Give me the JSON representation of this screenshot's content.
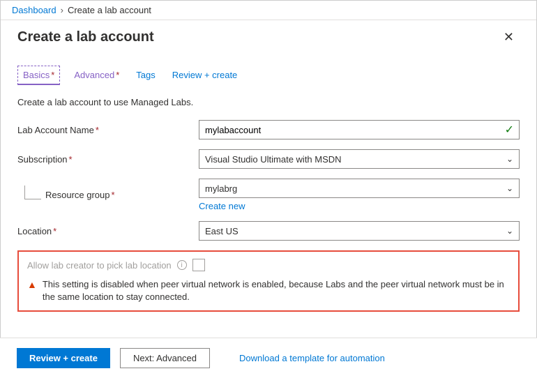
{
  "breadcrumb": {
    "root": "Dashboard",
    "current": "Create a lab account"
  },
  "header": {
    "title": "Create a lab account"
  },
  "tabs": {
    "basics": "Basics",
    "advanced": "Advanced",
    "tags": "Tags",
    "review": "Review + create"
  },
  "intro": "Create a lab account to use Managed Labs.",
  "form": {
    "labAccountName": {
      "label": "Lab Account Name",
      "value": "mylabaccount"
    },
    "subscription": {
      "label": "Subscription",
      "value": "Visual Studio Ultimate with MSDN"
    },
    "resourceGroup": {
      "label": "Resource group",
      "value": "mylabrg",
      "createNew": "Create new"
    },
    "location": {
      "label": "Location",
      "value": "East US"
    }
  },
  "allowBox": {
    "label": "Allow lab creator to pick lab location",
    "warning": "This setting is disabled when peer virtual network is enabled, because Labs and the peer virtual network must be in the same location to stay connected."
  },
  "footer": {
    "review": "Review + create",
    "next": "Next: Advanced",
    "download": "Download a template for automation"
  }
}
